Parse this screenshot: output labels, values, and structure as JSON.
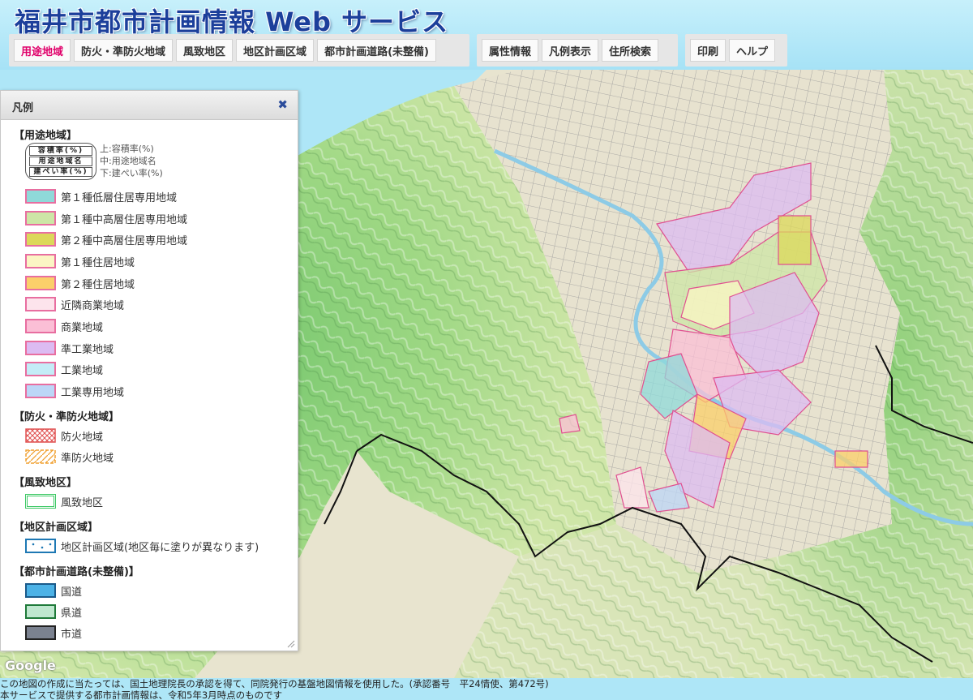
{
  "app": {
    "title": "福井市都市計画情報 Web サービス"
  },
  "toolbar": {
    "group1": [
      {
        "label": "用途地域",
        "active": true
      },
      {
        "label": "防火・準防火地域"
      },
      {
        "label": "風致地区"
      },
      {
        "label": "地区計画区域"
      },
      {
        "label": "都市計画道路(未整備)"
      }
    ],
    "group2": [
      {
        "label": "属性情報"
      },
      {
        "label": "凡例表示"
      },
      {
        "label": "住所検索"
      }
    ],
    "group3": [
      {
        "label": "印刷"
      },
      {
        "label": "ヘルプ"
      }
    ]
  },
  "legend": {
    "title": "凡例",
    "close_icon": "close-icon",
    "sections": {
      "youto": {
        "title": "【用途地域】",
        "hint_box": [
          "容積率(%)",
          "用途地域名",
          "建ぺい率(%)"
        ],
        "hint_lines": [
          "上:容積率(%)",
          "中:用途地域名",
          "下:建ぺい率(%)"
        ],
        "items": [
          {
            "label": "第１種低層住居専用地域",
            "color": "#8fd9d9"
          },
          {
            "label": "第１種中高層住居専用地域",
            "color": "#cde6a6"
          },
          {
            "label": "第２種中高層住居専用地域",
            "color": "#dcd85a"
          },
          {
            "label": "第１種住居地域",
            "color": "#fbf5c4"
          },
          {
            "label": "第２種住居地域",
            "color": "#fbcf6a"
          },
          {
            "label": "近隣商業地域",
            "color": "#fde4ec"
          },
          {
            "label": "商業地域",
            "color": "#fbbfd6"
          },
          {
            "label": "準工業地域",
            "color": "#dcbbf2"
          },
          {
            "label": "工業地域",
            "color": "#c4ecf7"
          },
          {
            "label": "工業専用地域",
            "color": "#bcd6f7"
          }
        ]
      },
      "bouka": {
        "title": "【防火・準防火地域】",
        "items": [
          {
            "label": "防火地域",
            "color": "#e05050"
          },
          {
            "label": "準防火地域",
            "color": "#f0a030"
          }
        ]
      },
      "fuuchi": {
        "title": "【風致地区】",
        "items": [
          {
            "label": "風致地区",
            "color": "#3cc864"
          }
        ]
      },
      "chiku": {
        "title": "【地区計画区域】",
        "items": [
          {
            "label": "地区計画区域(地区毎に塗りが異なります)",
            "color": "#1e78b4"
          }
        ]
      },
      "douro": {
        "title": "【都市計画道路(未整備)】",
        "items": [
          {
            "label": "国道",
            "color": "#4cb2e6"
          },
          {
            "label": "県道",
            "color": "#bfe8cf"
          },
          {
            "label": "市道",
            "color": "#7b8290"
          }
        ]
      }
    }
  },
  "map": {
    "provider": "Google"
  },
  "footer": {
    "line1": "この地図の作成に当たっては、国土地理院長の承認を得て、同院発行の基盤地図情報を使用した。(承認番号　平24情使、第472号)",
    "line2": "本サービスで提供する都市計画情報は、令和5年3月時点のものです"
  }
}
